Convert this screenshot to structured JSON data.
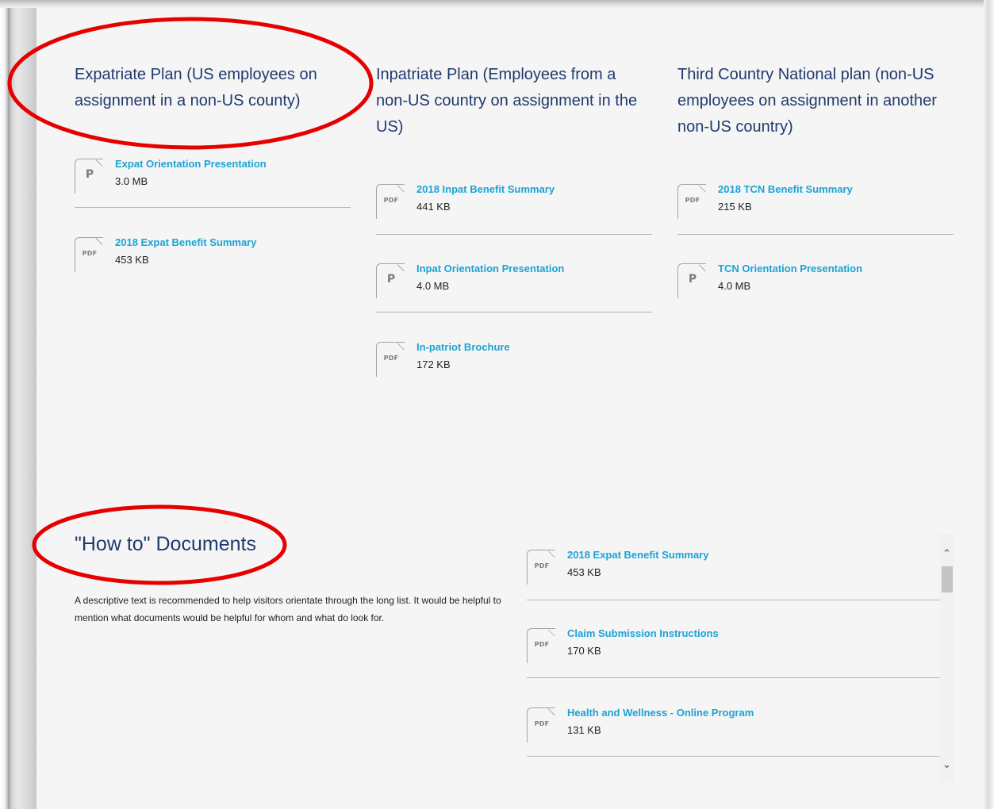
{
  "columns": [
    {
      "heading": "Expatriate Plan (US employees on assignment in a non-US county)",
      "docs": [
        {
          "title": "Expat Orientation Presentation",
          "size": "3.0 MB",
          "icon": "P"
        },
        {
          "title": "2018 Expat Benefit Summary",
          "size": "453 KB",
          "icon": "PDF"
        }
      ]
    },
    {
      "heading": "Inpatriate Plan (Employees from a non-US country on assignment in the US)",
      "docs": [
        {
          "title": "2018 Inpat Benefit Summary",
          "size": "441 KB",
          "icon": "PDF"
        },
        {
          "title": "Inpat Orientation Presentation",
          "size": "4.0 MB",
          "icon": "P"
        },
        {
          "title": "In-patriot Brochure",
          "size": "172 KB",
          "icon": "PDF"
        }
      ]
    },
    {
      "heading": "Third Country National plan (non-US employees on assignment in another non-US country)",
      "docs": [
        {
          "title": "2018 TCN Benefit Summary",
          "size": "215 KB",
          "icon": "PDF"
        },
        {
          "title": "TCN Orientation Presentation",
          "size": "4.0 MB",
          "icon": "P"
        }
      ]
    }
  ],
  "howto": {
    "title": "\"How to\" Documents",
    "description": "A descriptive text is recommended to help visitors orientate through the long list. It would be helpful to mention what documents would be helpful for whom and what do look for.",
    "docs": [
      {
        "title": "2018 Expat Benefit Summary",
        "size": "453 KB",
        "icon": "PDF"
      },
      {
        "title": "Claim Submission Instructions",
        "size": "170 KB",
        "icon": "PDF"
      },
      {
        "title": "Health and Wellness - Online Program",
        "size": "131 KB",
        "icon": "PDF"
      }
    ]
  },
  "colors": {
    "heading": "#1f3a6e",
    "link": "#1aa3d6",
    "annotation": "#e60000",
    "panel": "#f5f5f5"
  },
  "icons": {
    "pdf": "pdf-file-icon",
    "presentation": "presentation-file-icon",
    "scroll_up": "chevron-up-icon",
    "scroll_down": "chevron-down-icon"
  }
}
